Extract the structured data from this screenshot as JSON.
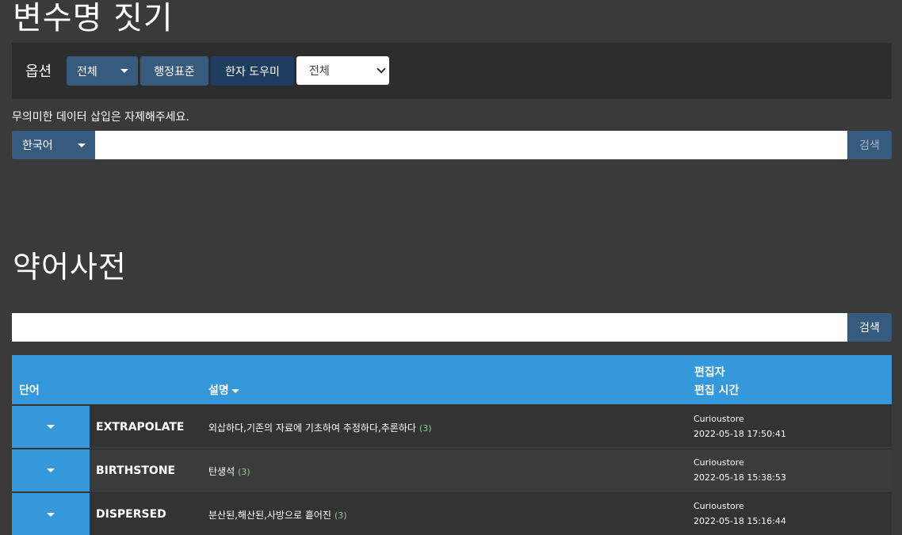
{
  "header": {
    "title": "변수명 짓기"
  },
  "options": {
    "label": "옵션",
    "scope_button": "전체",
    "admin_button": "행정표준",
    "hanja_button": "한자 도우미",
    "select_value": "전체"
  },
  "notice": "무의미한 데이터 삽입은 자제해주세요.",
  "search1": {
    "lang": "한국어",
    "button": "검색",
    "value": ""
  },
  "abbr": {
    "title": "약어사전"
  },
  "search2": {
    "button": "검색",
    "value": ""
  },
  "table": {
    "col_word": "단어",
    "col_desc": "설명",
    "col_editor": "편집자",
    "col_time": "편집 시간",
    "rows": [
      {
        "word": "EXTRAPOLATE",
        "desc": "외삽하다,기존의 자료에 기초하여 추정하다,추론하다",
        "count": "(3)",
        "editor": "Curioustore",
        "time": "2022-05-18 17:50:41"
      },
      {
        "word": "BIRTHSTONE",
        "desc": "탄생석",
        "count": "(3)",
        "editor": "Curioustore",
        "time": "2022-05-18 15:38:53"
      },
      {
        "word": "DISPERSED",
        "desc": "분산된,해산된,사방으로 흩어진",
        "count": "(3)",
        "editor": "Curioustore",
        "time": "2022-05-18 15:16:44"
      }
    ]
  },
  "colors": {
    "background": "#3a3a3a",
    "primary": "#375a7f",
    "info": "#3498db",
    "count": "#8bd08b"
  }
}
